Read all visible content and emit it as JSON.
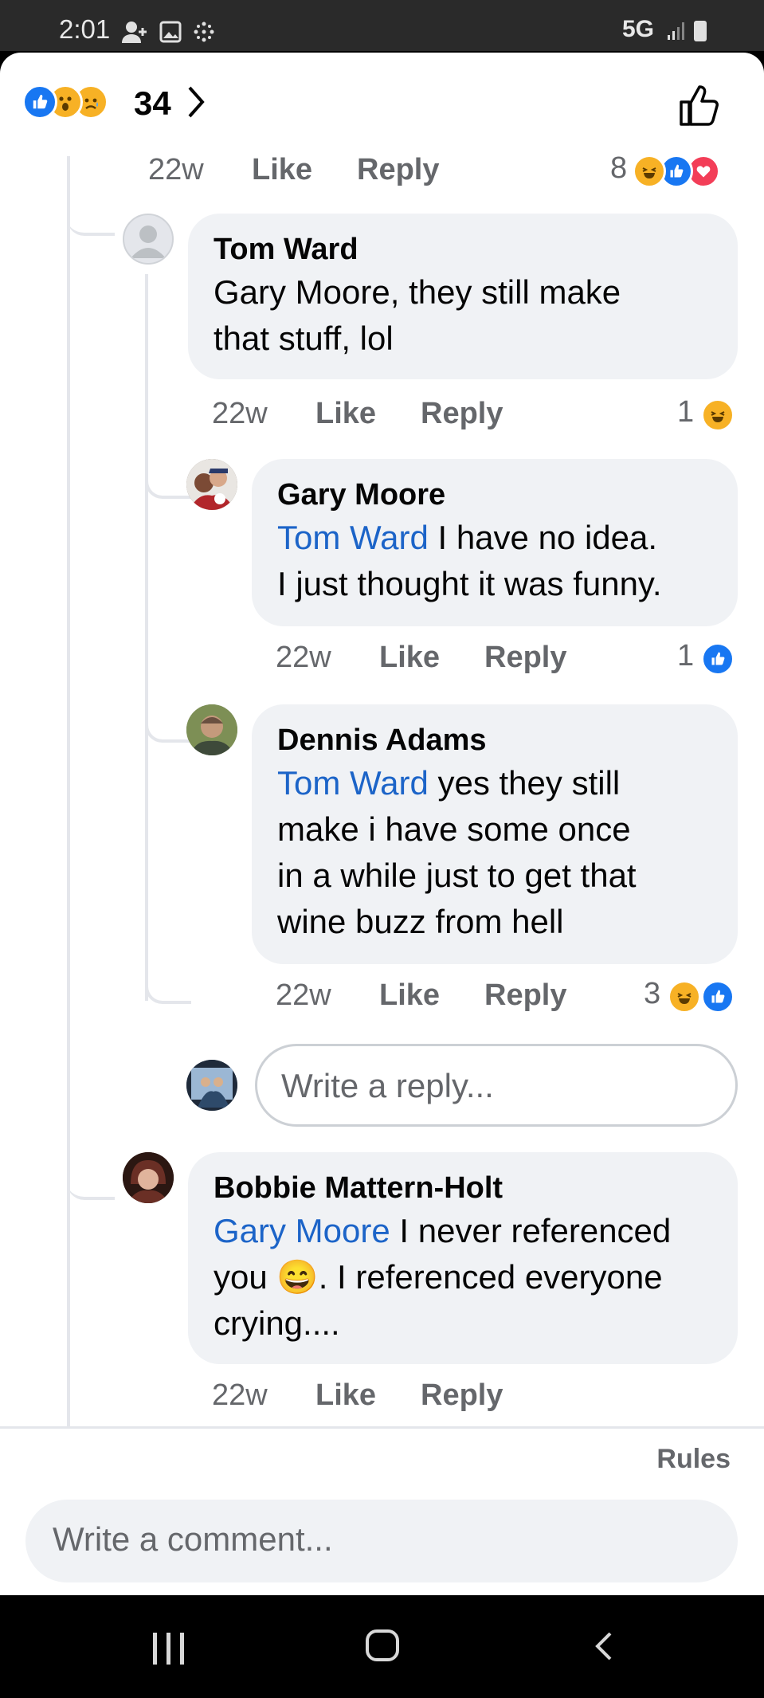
{
  "status_bar": {
    "time": "2:01",
    "network": "5G"
  },
  "reactions_summary": {
    "count": "34",
    "icons": [
      "like-icon",
      "wow-icon",
      "sad-icon"
    ]
  },
  "comments": [
    {
      "id": "tom",
      "author": "Tom Ward",
      "text_lines": [
        "Gary Moore,  they still make",
        "that stuff, lol"
      ],
      "age": "22w",
      "like": "Like",
      "reply": "Reply",
      "reaction_count": "1",
      "reaction_icons": [
        "haha-icon"
      ]
    },
    {
      "id": "gary",
      "author": "Gary Moore",
      "mention": "Tom Ward",
      "text_first": " I have no idea.",
      "text_lines": [
        "I just thought it was funny."
      ],
      "age": "22w",
      "like": "Like",
      "reply": "Reply",
      "reaction_count": "1",
      "reaction_icons": [
        "like-icon"
      ]
    },
    {
      "id": "dennis",
      "author": "Dennis Adams",
      "mention": "Tom Ward",
      "text_first": " yes they still",
      "text_lines": [
        "make  i have some once",
        "in a while  just to get that",
        "wine buzz from hell"
      ],
      "age": "22w",
      "like": "Like",
      "reply": "Reply",
      "reaction_count": "3",
      "reaction_icons": [
        "haha-icon",
        "like-icon"
      ]
    },
    {
      "id": "bobbie",
      "author": "Bobbie Mattern-Holt",
      "mention": "Gary Moore",
      "text_first": " I never referenced",
      "text_second_a": "you ",
      "text_second_emoji": "😄",
      "text_second_b": ".  I referenced everyone",
      "text_lines": [
        "crying...."
      ],
      "age": "22w",
      "like": "Like",
      "reply": "Reply"
    }
  ],
  "top_actions": {
    "age": "22w",
    "like": "Like",
    "reply": "Reply",
    "reaction_count": "8",
    "reaction_icons": [
      "haha-icon",
      "like-icon",
      "love-icon"
    ]
  },
  "reply_input": {
    "placeholder": "Write a reply..."
  },
  "footer": {
    "rules": "Rules",
    "comment_placeholder": "Write a comment..."
  },
  "colors": {
    "link": "#1c64c8",
    "bubble": "#f0f2f5",
    "muted": "#65676b",
    "like": "#1877f2",
    "love": "#f33e58",
    "haha": "#f7b125"
  }
}
